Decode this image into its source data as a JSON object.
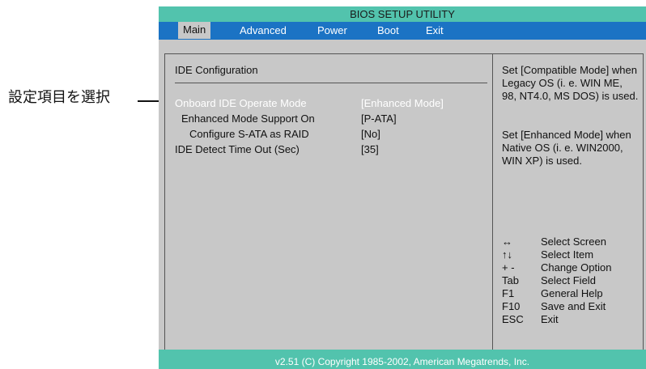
{
  "callout": {
    "label": "設定項目を選択"
  },
  "bios": {
    "title": "BIOS SETUP UTILITY",
    "menu": [
      "Main",
      "Advanced",
      "Power",
      "Boot",
      "Exit"
    ],
    "section_title": "IDE Configuration",
    "options": [
      {
        "label": "Onboard IDE Operate Mode",
        "value": "[Enhanced Mode]"
      },
      {
        "label": "Enhanced Mode Support On",
        "value": "[P-ATA]"
      },
      {
        "label": "Configure S-ATA as RAID",
        "value": "[No]"
      },
      {
        "label": "IDE Detect Time Out (Sec)",
        "value": "[35]"
      }
    ],
    "help": {
      "para1": "Set [Compatible Mode] when Legacy OS (i. e. WIN ME, 98, NT4.0, MS DOS) is used.",
      "para2": "Set [Enhanced Mode] when Native OS (i. e. WIN2000, WIN XP) is used."
    },
    "keys": [
      {
        "key": "↔",
        "desc": "Select Screen"
      },
      {
        "key": "↑↓",
        "desc": "Select Item"
      },
      {
        "key": "+ -",
        "desc": "Change Option"
      },
      {
        "key": "Tab",
        "desc": "Select Field"
      },
      {
        "key": "F1",
        "desc": "General Help"
      },
      {
        "key": "F10",
        "desc": "Save and Exit"
      },
      {
        "key": "ESC",
        "desc": "Exit"
      }
    ],
    "footer": "v2.51 (C) Copyright 1985-2002, American Megatrends, Inc."
  }
}
